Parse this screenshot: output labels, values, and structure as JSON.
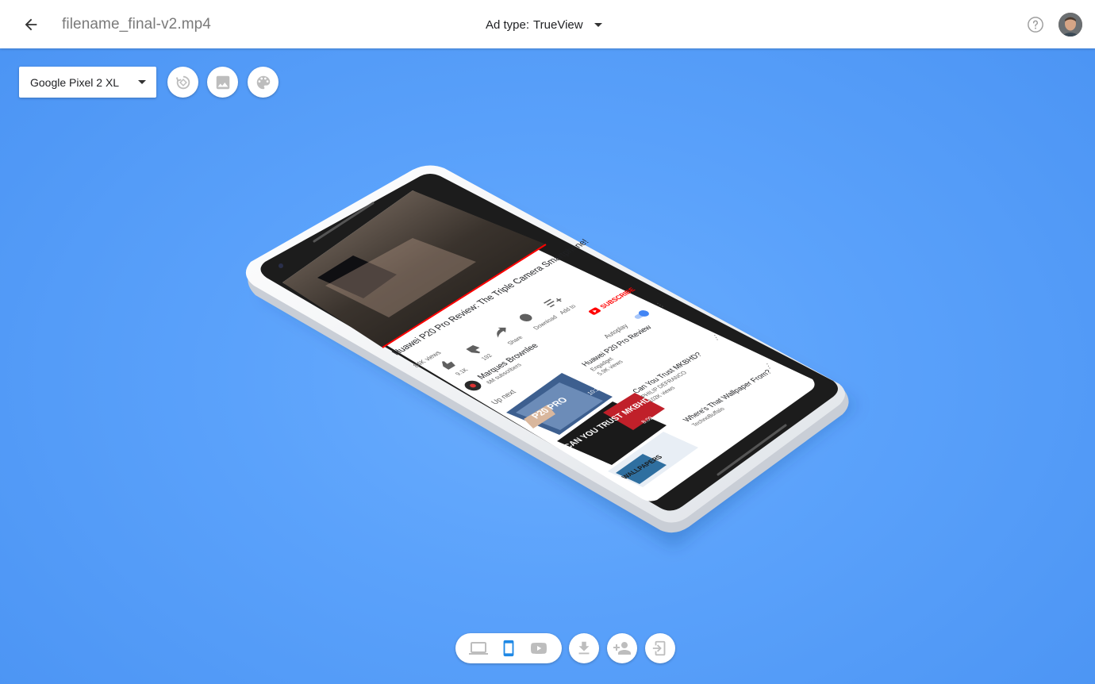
{
  "header": {
    "filename": "filename_final-v2.mp4",
    "ad_type_label": "Ad type:",
    "ad_type_value": "TrueView"
  },
  "toolbar": {
    "device_selected": "Google Pixel 2 XL"
  },
  "video": {
    "title": "Huawei P20 Pro Review: The Triple Camera Smartphone!",
    "views": "84K views",
    "likes": "9.1K",
    "dislikes": "192",
    "share_label": "Share",
    "download_label": "Download",
    "add_to_label": "Add to",
    "channel_name": "Marques Brownlee",
    "subscribers": "6M subscribers",
    "subscribe_label": "SUBSCRIBE",
    "up_next_label": "Up next",
    "autoplay_label": "Autoplay",
    "autoplay_on": true
  },
  "up_next": [
    {
      "title": "Huawei P20 Pro Review",
      "channel": "Engadget",
      "views": "5.9K views",
      "duration": "10:13",
      "thumb_text": "P20 PRO"
    },
    {
      "title": "Can You Trust MKBHD?",
      "channel": "PHILIP DEFRANCO",
      "views": "102K views",
      "duration": "8:09",
      "thumb_text": "CAN YOU TRUST MKBHD?"
    },
    {
      "title": "Where's That Wallpaper From?",
      "channel": "TechnoBuffalo",
      "views": "",
      "duration": "",
      "thumb_text": "WALLPAPERS"
    }
  ],
  "colors": {
    "accent": "#4285f4",
    "youtube_red": "#ff0000",
    "background": "#5ba2fb"
  },
  "icons": {
    "back": "arrow-left-icon",
    "help": "help-circle-icon",
    "rotate": "rotate-icon",
    "image": "image-icon",
    "palette": "palette-icon",
    "laptop": "laptop-icon",
    "phone": "smartphone-icon",
    "youtube": "youtube-icon",
    "download": "download-icon",
    "share_person": "person-add-icon",
    "exit": "exit-to-app-icon"
  }
}
